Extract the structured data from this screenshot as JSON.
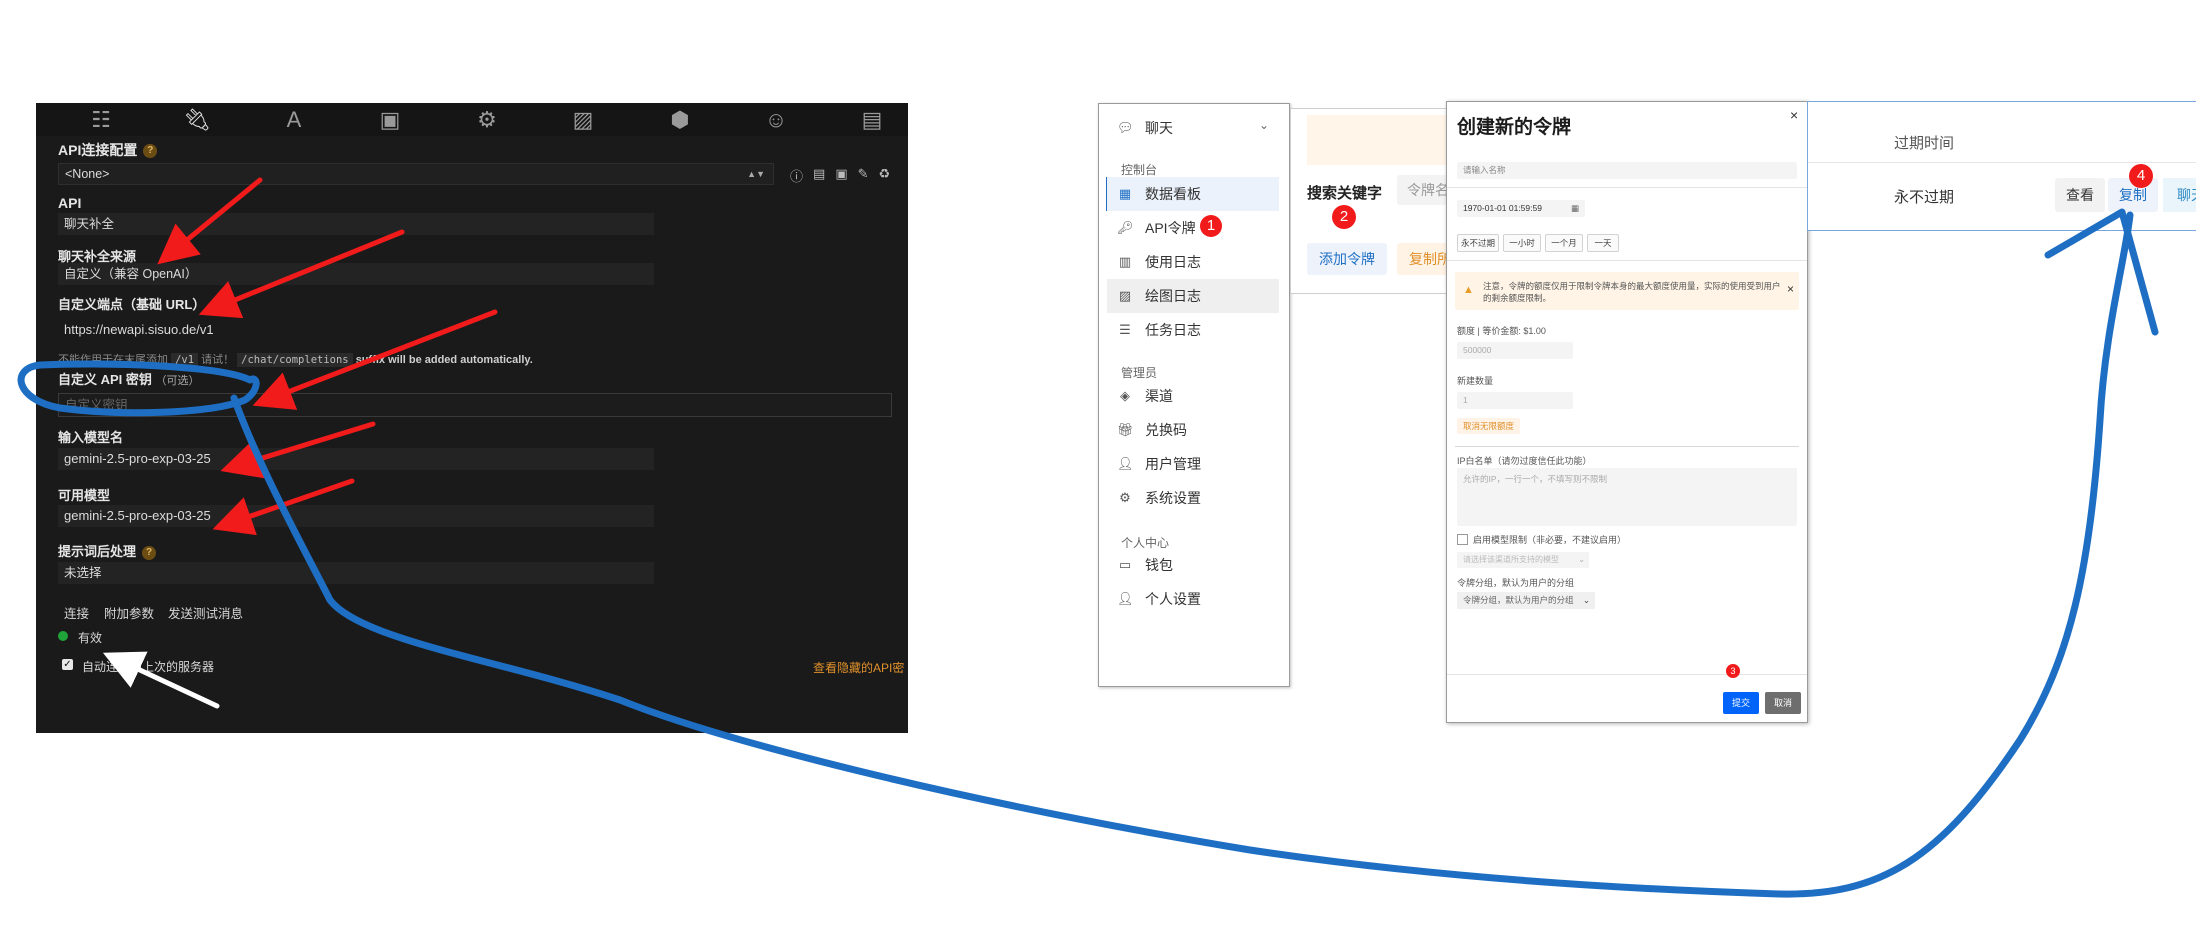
{
  "dark_panel": {
    "toolbar_icons": [
      "sliders-icon",
      "plug-icon",
      "font-icon",
      "book-icon",
      "user-gear-icon",
      "image-icon",
      "cubes-icon",
      "smile-icon",
      "id-card-icon"
    ],
    "section_title": "API连接配置",
    "profile_select": "<None>",
    "api_label": "API",
    "api_value": "聊天补全",
    "source_label": "聊天补全来源",
    "source_value": "自定义（兼容 OpenAI）",
    "endpoint_label": "自定义端点（基础 URL）",
    "endpoint_value": "https://newapi.sisuo.de/v1",
    "endpoint_hint_prefix": "不能作用于在末尾添加",
    "endpoint_hint_code1": "/v1",
    "endpoint_hint_mid": "请试！",
    "endpoint_hint_code2": "/chat/completions",
    "endpoint_hint_suffix": "suffix will be added automatically.",
    "key_label": "自定义 API 密钥",
    "key_optional": "（可选）",
    "key_placeholder": "自定义密钥",
    "model_input_label": "输入模型名",
    "model_input_value": "gemini-2.5-pro-exp-03-25",
    "available_label": "可用模型",
    "available_value": "gemini-2.5-pro-exp-03-25",
    "postprocess_label": "提示词后处理",
    "postprocess_value": "未选择",
    "connect_button": "连接",
    "extra_params_button": "附加参数",
    "send_test_button": "发送测试消息",
    "status_text": "有效",
    "auto_connect_label": "自动连接到上次的服务器",
    "view_hidden_link": "查看隐藏的API密"
  },
  "sidebar": {
    "chat_label": "聊天",
    "console_section": "控制台",
    "items_console": [
      {
        "label": "数据看板",
        "icon": "dashboard-icon"
      },
      {
        "label": "API令牌",
        "icon": "key-icon"
      },
      {
        "label": "使用日志",
        "icon": "bar-chart-icon"
      },
      {
        "label": "绘图日志",
        "icon": "image-icon"
      },
      {
        "label": "任务日志",
        "icon": "task-list-icon"
      }
    ],
    "admin_section": "管理员",
    "items_admin": [
      {
        "label": "渠道",
        "icon": "layers-icon"
      },
      {
        "label": "兑换码",
        "icon": "gift-icon"
      },
      {
        "label": "用户管理",
        "icon": "user-icon"
      },
      {
        "label": "系统设置",
        "icon": "gear-icon"
      }
    ],
    "personal_section": "个人中心",
    "items_personal": [
      {
        "label": "钱包",
        "icon": "wallet-icon"
      },
      {
        "label": "个人设置",
        "icon": "user-icon"
      }
    ]
  },
  "middle": {
    "search_label": "搜索关键字",
    "search_placeholder": "令牌名",
    "add_button": "添加令牌",
    "copy_button": "复制所"
  },
  "modal": {
    "title": "创建新的令牌",
    "name_placeholder": "请输入名称",
    "expire_value": "1970-01-01 01:59:59",
    "expire_options": [
      "永不过期",
      "一小时",
      "一个月",
      "一天"
    ],
    "warning_text": "注意，令牌的额度仅用于限制令牌本身的最大额度使用量，实际的使用受到用户的剩余额度限制。",
    "quota_label": "额度 | 等价金额: $1.00",
    "quota_value": "500000",
    "count_label": "新建数量",
    "count_value": "1",
    "unlimited_button": "取消无限额度",
    "ip_label": "IP白名单（请勿过度信任此功能）",
    "ip_placeholder": "允许的IP，一行一个，不填写则不限制",
    "model_limit_label": "启用模型限制（非必要，不建议启用）",
    "model_select_placeholder": "请选择该渠道所支持的模型",
    "group_label": "令牌分组，默认为用户的分组",
    "group_select": "令牌分组，默认为用户的分组",
    "submit_button": "提交",
    "cancel_button": "取消"
  },
  "right": {
    "expire_header": "过期时间",
    "expire_value": "永不过期",
    "view_button": "查看",
    "copy_button": "复制",
    "chat_button": "聊天"
  },
  "badges": [
    "1",
    "2",
    "3",
    "4"
  ],
  "colors": {
    "annotation_red": "#f21b1b",
    "annotation_blue": "#1e6fc4",
    "primary_blue": "#0064fa",
    "valid_green": "#1fa33a",
    "link_orange": "#e0902a"
  }
}
